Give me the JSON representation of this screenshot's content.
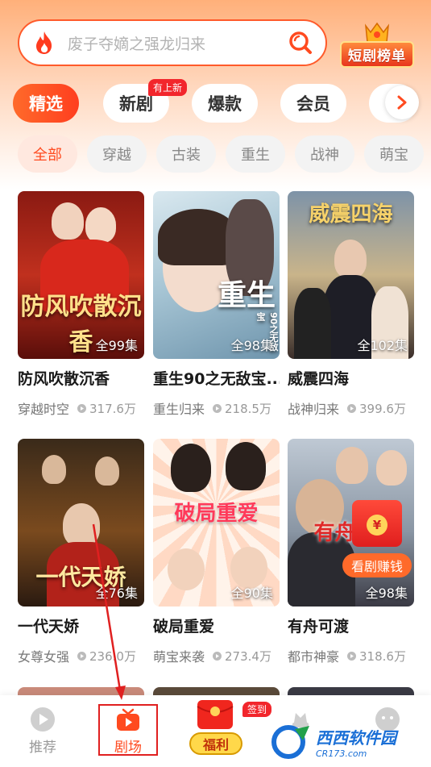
{
  "search": {
    "placeholder": "废子夺嫡之强龙归来"
  },
  "ranking": {
    "label": "短剧榜单"
  },
  "main_tabs": [
    {
      "label": "精选",
      "active": true
    },
    {
      "label": "新剧",
      "badge": "有上新"
    },
    {
      "label": "爆款"
    },
    {
      "label": "会员"
    }
  ],
  "genres": [
    {
      "label": "全部",
      "active": true
    },
    {
      "label": "穿越"
    },
    {
      "label": "古装"
    },
    {
      "label": "重生"
    },
    {
      "label": "战神"
    },
    {
      "label": "萌宝"
    }
  ],
  "dramas": [
    {
      "title": "防风吹散沉香",
      "poster_title": "防风吹散沉香",
      "episodes": "全99集",
      "tag": "穿越时空",
      "plays": "317.6万"
    },
    {
      "title": "重生90之无敌宝...",
      "poster_title": "重生",
      "poster_sub": "90之无敌宝",
      "episodes": "全98集",
      "tag": "重生归来",
      "plays": "218.5万"
    },
    {
      "title": "威震四海",
      "poster_title": "威震四海",
      "episodes": "全102集",
      "tag": "战神归来",
      "plays": "399.6万"
    },
    {
      "title": "一代天娇",
      "poster_title": "一代天娇",
      "episodes": "全76集",
      "tag": "女尊女强",
      "plays": "236.0万"
    },
    {
      "title": "破局重爱",
      "poster_title": "破局重爱",
      "episodes": "全90集",
      "tag": "萌宝来袭",
      "plays": "273.4万"
    },
    {
      "title": "有舟可渡",
      "poster_title": "有舟",
      "episodes": "全98集",
      "tag": "都市神豪",
      "plays": "318.6万"
    }
  ],
  "promo": {
    "coin": "¥",
    "label": "看剧赚钱"
  },
  "bottom_nav": [
    {
      "label": "推荐",
      "icon": "play-circle-icon"
    },
    {
      "label": "剧场",
      "icon": "tv-icon",
      "active": true
    },
    {
      "label": "福利",
      "icon": "red-packet-icon",
      "badge": "签到"
    },
    {
      "label": "",
      "icon": "hat-icon"
    },
    {
      "label": "",
      "icon": "profile-icon"
    }
  ],
  "watermark": {
    "main": "西西软件园",
    "sub": "CR173.com"
  },
  "colors": {
    "accent": "#ff4a1f",
    "search_border": "#ff5a2a",
    "badge_red": "#f2262c",
    "annotation_red": "#e02020"
  }
}
